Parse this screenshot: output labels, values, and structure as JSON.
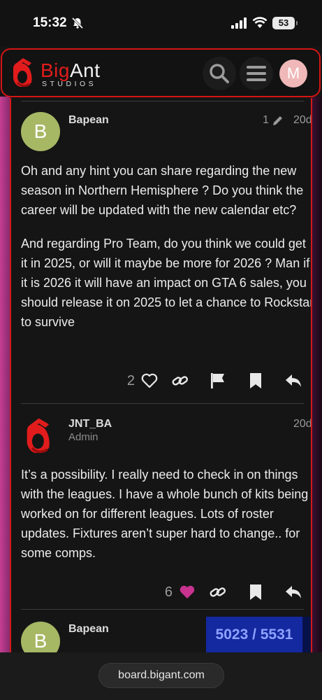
{
  "status_bar": {
    "time": "15:32",
    "battery": "53"
  },
  "header": {
    "logo_word": "BIGANT",
    "logo_word_big": "Big",
    "logo_word_rest": "Ant",
    "logo_sub": "STUDIOS",
    "user_initial": "M",
    "icons": [
      "search-icon",
      "hamburger-icon"
    ]
  },
  "posts": [
    {
      "avatar_letter": "B",
      "username": "Bapean",
      "edit_count": "1",
      "age": "20d",
      "paragraphs": [
        "Oh and any hint you can share regarding the new season in Northern Hemisphere ? Do you think the career will be updated with the new calendar etc?",
        "And regarding Pro Team, do you think we could get it in 2025, or will it maybe be more for 2026 ? Man if it is 2026 it will have an impact on GTA 6 sales, you should release it on 2025 to let a chance to Rockstar to survive"
      ],
      "likes": "2"
    },
    {
      "username": "JNT_BA",
      "role": "Admin",
      "age": "20d",
      "paragraphs": [
        "It’s a possibility. I really need to check in on things with the leagues. I have a whole bunch of kits being worked on for different leagues. Lots of roster updates. Fixtures aren’t super hard to change.. for some comps."
      ],
      "likes": "6"
    },
    {
      "avatar_letter": "B",
      "username": "Bapean"
    }
  ],
  "progress": "5023 / 5531",
  "url": "board.bigant.com",
  "colors": {
    "accent_red": "#d61414",
    "like_pink": "#c8338f",
    "progress_blue": "#1428a0"
  }
}
